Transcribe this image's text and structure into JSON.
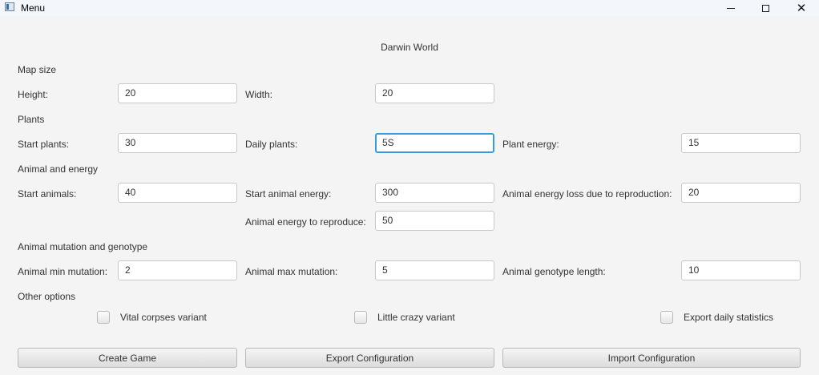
{
  "window": {
    "title": "Menu"
  },
  "app_title": "Darwin World",
  "sections": {
    "map_size": "Map size",
    "plants": "Plants",
    "animal_energy": "Animal and energy",
    "mutation": "Animal mutation and genotype",
    "other": "Other options"
  },
  "fields": {
    "height": {
      "label": "Height:",
      "value": "20"
    },
    "width": {
      "label": "Width:",
      "value": "20"
    },
    "start_plants": {
      "label": "Start plants:",
      "value": "30"
    },
    "daily_plants": {
      "label": "Daily plants:",
      "value": "5S"
    },
    "plant_energy": {
      "label": "Plant energy:",
      "value": "15"
    },
    "start_animals": {
      "label": "Start animals:",
      "value": "40"
    },
    "start_animal_energy": {
      "label": "Start animal energy:",
      "value": "300"
    },
    "energy_loss_reproduction": {
      "label": "Animal energy loss due to reproduction:",
      "value": "20"
    },
    "energy_to_reproduce": {
      "label": "Animal energy to reproduce:",
      "value": "50"
    },
    "min_mutation": {
      "label": "Animal min mutation:",
      "value": "2"
    },
    "max_mutation": {
      "label": "Animal max mutation:",
      "value": "5"
    },
    "genotype_length": {
      "label": "Animal genotype length:",
      "value": "10"
    }
  },
  "options": {
    "vital_corpses": {
      "label": "Vital corpses variant",
      "checked": false
    },
    "little_crazy": {
      "label": "Little crazy variant",
      "checked": false
    },
    "export_stats": {
      "label": "Export daily statistics",
      "checked": false
    }
  },
  "buttons": {
    "create": "Create Game",
    "export": "Export Configuration",
    "import": "Import Configuration"
  }
}
